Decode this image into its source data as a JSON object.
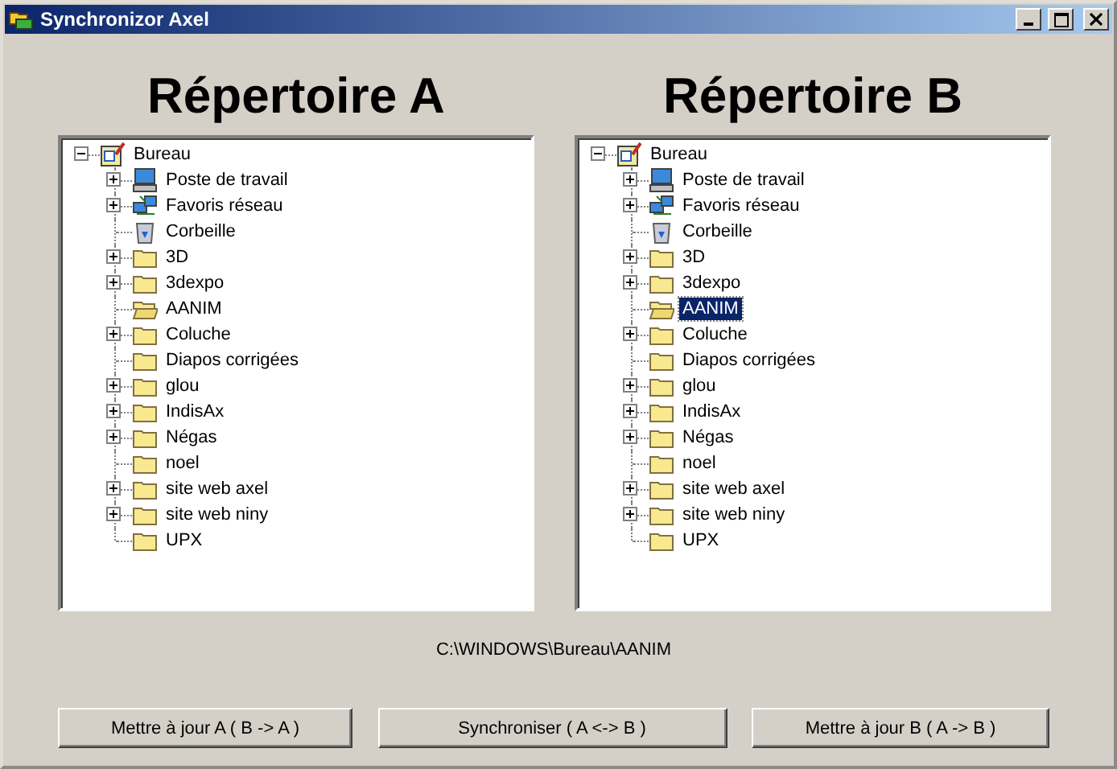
{
  "window": {
    "title": "Synchronizor Axel"
  },
  "panels": [
    {
      "heading": "Répertoire A",
      "tree": {
        "label": "Bureau",
        "kind": "desktop",
        "expanded": true,
        "selected": false,
        "children": [
          {
            "label": "Poste de travail",
            "kind": "computer",
            "expandable": true,
            "selected": false
          },
          {
            "label": "Favoris réseau",
            "kind": "network",
            "expandable": true,
            "selected": false
          },
          {
            "label": "Corbeille",
            "kind": "recycle",
            "expandable": false,
            "selected": false
          },
          {
            "label": "3D",
            "kind": "folder",
            "expandable": true,
            "selected": false
          },
          {
            "label": "3dexpo",
            "kind": "folder",
            "expandable": true,
            "selected": false
          },
          {
            "label": "AANIM",
            "kind": "folder-open",
            "expandable": false,
            "selected": false
          },
          {
            "label": "Coluche",
            "kind": "folder",
            "expandable": true,
            "selected": false
          },
          {
            "label": "Diapos corrigées",
            "kind": "folder",
            "expandable": false,
            "selected": false
          },
          {
            "label": "glou",
            "kind": "folder",
            "expandable": true,
            "selected": false
          },
          {
            "label": "IndisAx",
            "kind": "folder",
            "expandable": true,
            "selected": false
          },
          {
            "label": "Négas",
            "kind": "folder",
            "expandable": true,
            "selected": false
          },
          {
            "label": "noel",
            "kind": "folder",
            "expandable": false,
            "selected": false
          },
          {
            "label": "site web axel",
            "kind": "folder",
            "expandable": true,
            "selected": false
          },
          {
            "label": "site web niny",
            "kind": "folder",
            "expandable": true,
            "selected": false
          },
          {
            "label": "UPX",
            "kind": "folder",
            "expandable": false,
            "selected": false
          }
        ]
      }
    },
    {
      "heading": "Répertoire B",
      "tree": {
        "label": "Bureau",
        "kind": "desktop",
        "expanded": true,
        "selected": false,
        "children": [
          {
            "label": "Poste de travail",
            "kind": "computer",
            "expandable": true,
            "selected": false
          },
          {
            "label": "Favoris réseau",
            "kind": "network",
            "expandable": true,
            "selected": false
          },
          {
            "label": "Corbeille",
            "kind": "recycle",
            "expandable": false,
            "selected": false
          },
          {
            "label": "3D",
            "kind": "folder",
            "expandable": true,
            "selected": false
          },
          {
            "label": "3dexpo",
            "kind": "folder",
            "expandable": true,
            "selected": false
          },
          {
            "label": "AANIM",
            "kind": "folder-open",
            "expandable": false,
            "selected": true
          },
          {
            "label": "Coluche",
            "kind": "folder",
            "expandable": true,
            "selected": false
          },
          {
            "label": "Diapos corrigées",
            "kind": "folder",
            "expandable": false,
            "selected": false
          },
          {
            "label": "glou",
            "kind": "folder",
            "expandable": true,
            "selected": false
          },
          {
            "label": "IndisAx",
            "kind": "folder",
            "expandable": true,
            "selected": false
          },
          {
            "label": "Négas",
            "kind": "folder",
            "expandable": true,
            "selected": false
          },
          {
            "label": "noel",
            "kind": "folder",
            "expandable": false,
            "selected": false
          },
          {
            "label": "site web axel",
            "kind": "folder",
            "expandable": true,
            "selected": false
          },
          {
            "label": "site web niny",
            "kind": "folder",
            "expandable": true,
            "selected": false
          },
          {
            "label": "UPX",
            "kind": "folder",
            "expandable": false,
            "selected": false
          }
        ]
      }
    }
  ],
  "path": "C:\\WINDOWS\\Bureau\\AANIM",
  "buttons": [
    "Mettre à jour A ( B -> A )",
    "Synchroniser ( A <-> B )",
    "Mettre à jour B ( A -> B )"
  ]
}
